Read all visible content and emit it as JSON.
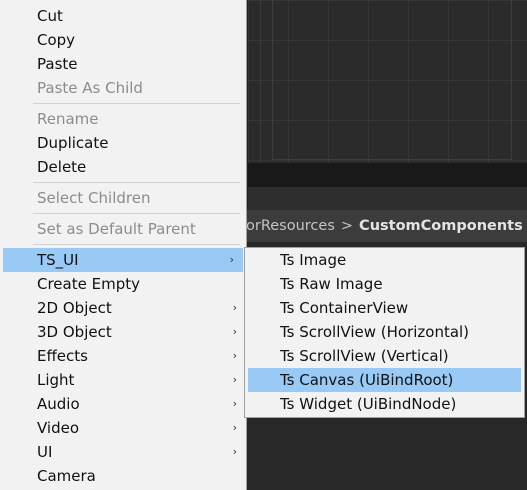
{
  "breadcrumb": {
    "prev": "orResources",
    "separator": ">",
    "current": "CustomComponents"
  },
  "context_menu": {
    "items": [
      {
        "label": "Cut",
        "enabled": true
      },
      {
        "label": "Copy",
        "enabled": true
      },
      {
        "label": "Paste",
        "enabled": true
      },
      {
        "label": "Paste As Child",
        "enabled": false
      },
      {
        "label": "Rename",
        "enabled": false
      },
      {
        "label": "Duplicate",
        "enabled": true
      },
      {
        "label": "Delete",
        "enabled": true
      },
      {
        "label": "Select Children",
        "enabled": false
      },
      {
        "label": "Set as Default Parent",
        "enabled": false
      },
      {
        "label": "TS_UI",
        "submenu": true,
        "highlighted": true
      },
      {
        "label": "Create Empty"
      },
      {
        "label": "2D Object",
        "submenu": true
      },
      {
        "label": "3D Object",
        "submenu": true
      },
      {
        "label": "Effects",
        "submenu": true
      },
      {
        "label": "Light",
        "submenu": true
      },
      {
        "label": "Audio",
        "submenu": true
      },
      {
        "label": "Video",
        "submenu": true
      },
      {
        "label": "UI",
        "submenu": true
      },
      {
        "label": "Camera"
      }
    ],
    "arrow_glyph": "›"
  },
  "submenu": {
    "items": [
      {
        "label": "Ts Image"
      },
      {
        "label": "Ts Raw Image"
      },
      {
        "label": "Ts ContainerView"
      },
      {
        "label": "Ts ScrollView (Horizontal)"
      },
      {
        "label": "Ts ScrollView (Vertical)"
      },
      {
        "label": "Ts Canvas (UiBindRoot)",
        "highlighted": true
      },
      {
        "label": "Ts Widget (UiBindNode)"
      }
    ]
  },
  "colors": {
    "highlight": "#99c9f5",
    "menu_bg": "#f2f2f2",
    "disabled_text": "#8c8c8c"
  }
}
